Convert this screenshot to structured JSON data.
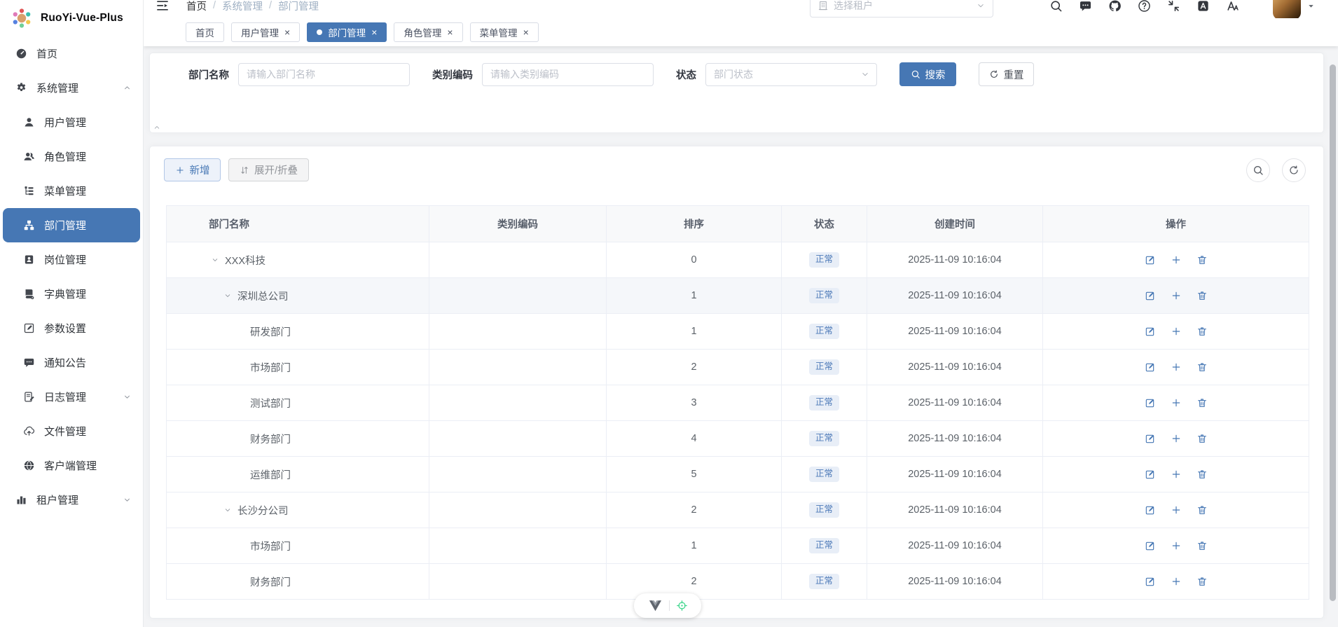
{
  "app": {
    "title": "RuoYi-Vue-Plus"
  },
  "colors": {
    "accent": "#4677b4",
    "status_badge_bg": "#e8eef7",
    "status_badge_text": "#4c79b8",
    "devtools_target_green": "#3dd68c"
  },
  "sidebar": {
    "items": [
      {
        "key": "home",
        "label": "首页",
        "icon": "dashboard-icon",
        "level": "top"
      },
      {
        "key": "system",
        "label": "系统管理",
        "icon": "gear-icon",
        "level": "top",
        "chevron": "up"
      },
      {
        "key": "user",
        "label": "用户管理",
        "icon": "user-icon",
        "level": "sub"
      },
      {
        "key": "role",
        "label": "角色管理",
        "icon": "users-icon",
        "level": "sub"
      },
      {
        "key": "menu",
        "label": "菜单管理",
        "icon": "menu-tree-icon",
        "level": "sub"
      },
      {
        "key": "dept",
        "label": "部门管理",
        "icon": "org-tree-icon",
        "level": "sub",
        "active": true
      },
      {
        "key": "post",
        "label": "岗位管理",
        "icon": "id-badge-icon",
        "level": "sub"
      },
      {
        "key": "dict",
        "label": "字典管理",
        "icon": "book-icon",
        "level": "sub"
      },
      {
        "key": "config",
        "label": "参数设置",
        "icon": "edit-square-icon",
        "level": "sub"
      },
      {
        "key": "notice",
        "label": "通知公告",
        "icon": "chat-bubble-icon",
        "level": "sub"
      },
      {
        "key": "log",
        "label": "日志管理",
        "icon": "log-document-icon",
        "level": "sub",
        "chevron": "down"
      },
      {
        "key": "file",
        "label": "文件管理",
        "icon": "cloud-upload-icon",
        "level": "sub"
      },
      {
        "key": "client",
        "label": "客户端管理",
        "icon": "globe-icon",
        "level": "sub"
      },
      {
        "key": "tenant",
        "label": "租户管理",
        "icon": "bar-chart-icon",
        "level": "top",
        "chevron": "down"
      }
    ]
  },
  "header": {
    "breadcrumb": [
      {
        "label": "首页"
      },
      {
        "label": "系统管理"
      },
      {
        "label": "部门管理"
      }
    ],
    "tenant_select": {
      "placeholder": "选择租户",
      "icon": "building-icon"
    },
    "icons": [
      {
        "key": "search",
        "icon": "search-icon"
      },
      {
        "key": "message",
        "icon": "message-icon"
      },
      {
        "key": "github",
        "icon": "github-icon"
      },
      {
        "key": "help",
        "icon": "help-icon"
      },
      {
        "key": "fullscreen",
        "icon": "compress-icon"
      },
      {
        "key": "translate",
        "icon": "translate-icon"
      },
      {
        "key": "font-size",
        "icon": "font-size-icon"
      }
    ]
  },
  "tabs": [
    {
      "key": "home",
      "label": "首页",
      "closable": false
    },
    {
      "key": "user",
      "label": "用户管理",
      "closable": true
    },
    {
      "key": "dept",
      "label": "部门管理",
      "closable": true,
      "active": true
    },
    {
      "key": "role",
      "label": "角色管理",
      "closable": true
    },
    {
      "key": "menu",
      "label": "菜单管理",
      "closable": true
    }
  ],
  "search_form": {
    "fields": [
      {
        "key": "dept-name",
        "label": "部门名称",
        "placeholder": "请输入部门名称",
        "type": "input"
      },
      {
        "key": "category-code",
        "label": "类别编码",
        "placeholder": "请输入类别编码",
        "type": "input"
      },
      {
        "key": "status",
        "label": "状态",
        "placeholder": "部门状态",
        "type": "select"
      }
    ],
    "search_label": "搜索",
    "reset_label": "重置"
  },
  "toolbar": {
    "add_label": "新增",
    "expand_label": "展开/折叠"
  },
  "table": {
    "columns": [
      "部门名称",
      "类别编码",
      "排序",
      "状态",
      "创建时间",
      "操作"
    ],
    "rows": [
      {
        "name": "XXX科技",
        "level": 0,
        "expandable": true,
        "category_code": "",
        "sort": "0",
        "status": "正常",
        "created": "2025-11-09 10:16:04",
        "highlighted": false
      },
      {
        "name": "深圳总公司",
        "level": 1,
        "expandable": true,
        "category_code": "",
        "sort": "1",
        "status": "正常",
        "created": "2025-11-09 10:16:04",
        "highlighted": true
      },
      {
        "name": "研发部门",
        "level": 2,
        "expandable": false,
        "category_code": "",
        "sort": "1",
        "status": "正常",
        "created": "2025-11-09 10:16:04",
        "highlighted": false
      },
      {
        "name": "市场部门",
        "level": 2,
        "expandable": false,
        "category_code": "",
        "sort": "2",
        "status": "正常",
        "created": "2025-11-09 10:16:04",
        "highlighted": false
      },
      {
        "name": "测试部门",
        "level": 2,
        "expandable": false,
        "category_code": "",
        "sort": "3",
        "status": "正常",
        "created": "2025-11-09 10:16:04",
        "highlighted": false
      },
      {
        "name": "财务部门",
        "level": 2,
        "expandable": false,
        "category_code": "",
        "sort": "4",
        "status": "正常",
        "created": "2025-11-09 10:16:04",
        "highlighted": false
      },
      {
        "name": "运维部门",
        "level": 2,
        "expandable": false,
        "category_code": "",
        "sort": "5",
        "status": "正常",
        "created": "2025-11-09 10:16:04",
        "highlighted": false
      },
      {
        "name": "长沙分公司",
        "level": 1,
        "expandable": true,
        "category_code": "",
        "sort": "2",
        "status": "正常",
        "created": "2025-11-09 10:16:04",
        "highlighted": false
      },
      {
        "name": "市场部门",
        "level": 2,
        "expandable": false,
        "category_code": "",
        "sort": "1",
        "status": "正常",
        "created": "2025-11-09 10:16:04",
        "highlighted": false
      },
      {
        "name": "财务部门",
        "level": 2,
        "expandable": false,
        "category_code": "",
        "sort": "2",
        "status": "正常",
        "created": "2025-11-09 10:16:04",
        "highlighted": false
      }
    ]
  },
  "devtools": {
    "icons": [
      "vue-logo",
      "target-icon"
    ]
  }
}
